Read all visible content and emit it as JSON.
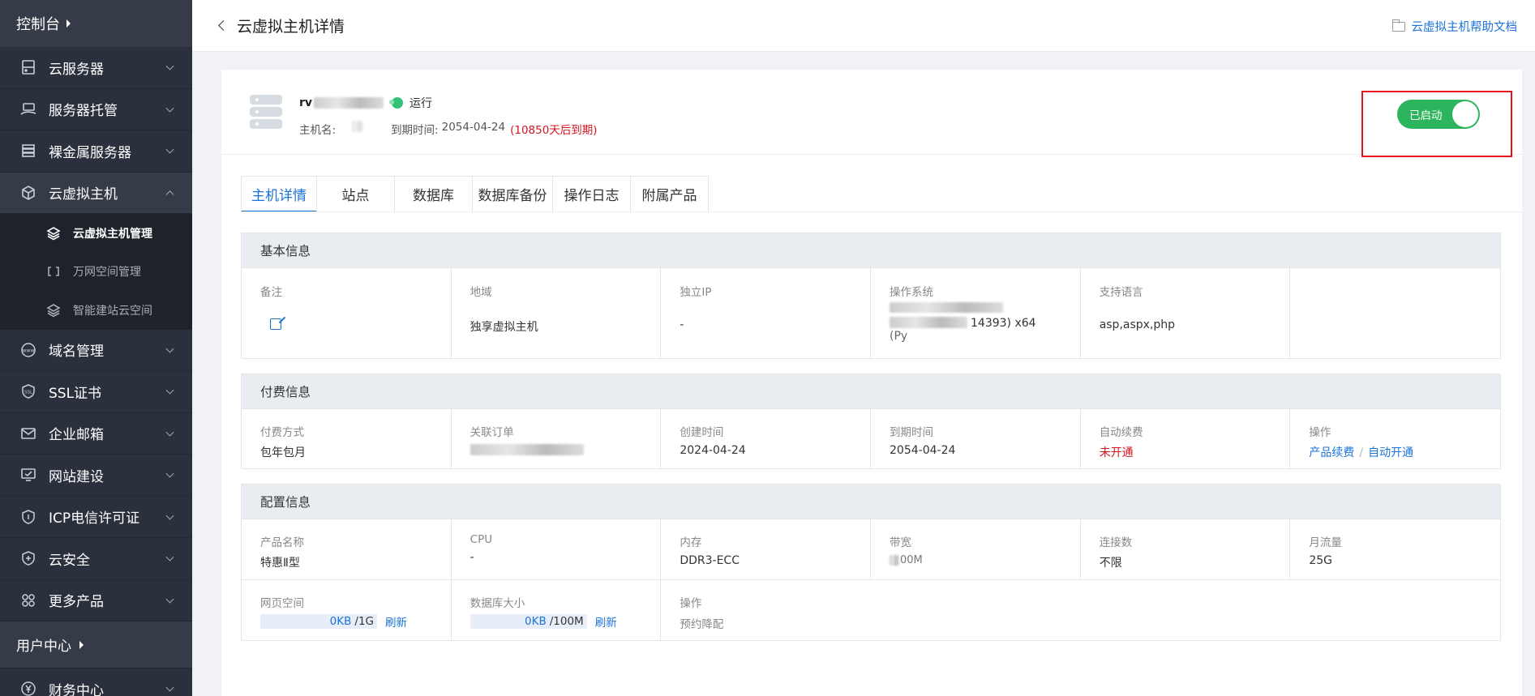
{
  "sidebar": {
    "top_label": "控制台",
    "items_a": [
      {
        "label": "云服务器",
        "icon": "server-icon"
      },
      {
        "label": "服务器托管",
        "icon": "hosting-icon"
      },
      {
        "label": "裸金属服务器",
        "icon": "baremetal-icon"
      },
      {
        "label": "云虚拟主机",
        "icon": "cube-icon"
      }
    ],
    "sub_items": [
      {
        "label": "云虚拟主机管理",
        "icon": "layers-icon",
        "active": true
      },
      {
        "label": "万网空间管理",
        "icon": "link-box-icon",
        "active": false
      },
      {
        "label": "智能建站云空间",
        "icon": "layers-icon",
        "active": false
      }
    ],
    "items_b": [
      {
        "label": "域名管理",
        "icon": "www-icon"
      },
      {
        "label": "SSL证书",
        "icon": "ssl-shield-icon"
      },
      {
        "label": "企业邮箱",
        "icon": "mail-icon"
      },
      {
        "label": "网站建设",
        "icon": "monitor-icon"
      },
      {
        "label": "ICP电信许可证",
        "icon": "icp-shield-icon"
      },
      {
        "label": "云安全",
        "icon": "plus-shield-icon"
      },
      {
        "label": "更多产品",
        "icon": "grid-icon"
      }
    ],
    "user_center": "用户中心",
    "finance": "财务中心"
  },
  "header": {
    "title": "云虚拟主机详情",
    "help_link": "云虚拟主机帮助文档"
  },
  "host": {
    "name_prefix": "rv",
    "status": "运行",
    "hostname_label": "主机名:",
    "expire_label": "到期时间:",
    "expire_date": "2054-04-24",
    "expire_remain": "(10850天后到期)",
    "switch_label": "已启动"
  },
  "tabs": [
    "主机详情",
    "站点",
    "数据库",
    "数据库备份",
    "操作日志",
    "附属产品"
  ],
  "basic": {
    "title": "基本信息",
    "note_label": "备注",
    "region_label": "地域",
    "region": "独享虚拟主机",
    "ip_label": "独立IP",
    "ip": "-",
    "os_label": "操作系统",
    "os_fragment_1": "14393) x64",
    "os_fragment_2": "(Py",
    "lang_label": "支持语言",
    "lang": "asp,aspx,php"
  },
  "billing": {
    "title": "付费信息",
    "pay_label": "付费方式",
    "pay": "包年包月",
    "order_label": "关联订单",
    "created_label": "创建时间",
    "created": "2024-04-24",
    "expire_label": "到期时间",
    "expire": "2054-04-24",
    "renew_label": "自动续费",
    "renew": "未开通",
    "ops_label": "操作",
    "op_renew": "产品续费",
    "op_sep": "/",
    "op_auto": "自动开通"
  },
  "config": {
    "title": "配置信息",
    "product_label": "产品名称",
    "product": "特惠Ⅱ型",
    "cpu_label": "CPU",
    "cpu": "-",
    "mem_label": "内存",
    "mem": "DDR3-ECC",
    "bw_label": "带宽",
    "bw_fragment": "00M",
    "conn_label": "连接数",
    "conn": "不限",
    "traffic_label": "月流量",
    "traffic": "25G",
    "web_label": "网页空间",
    "web_used": "0KB",
    "web_total": "/1G",
    "db_label": "数据库大小",
    "db_used": "0KB",
    "db_total": "/100M",
    "refresh": "刷新",
    "ops_label": "操作",
    "ops_value": "预约降配"
  },
  "colors": {
    "sidebar_bg": "#2b313c",
    "accent": "#1a73d9",
    "switch_on": "#2db55d",
    "danger": "#d4141e"
  }
}
